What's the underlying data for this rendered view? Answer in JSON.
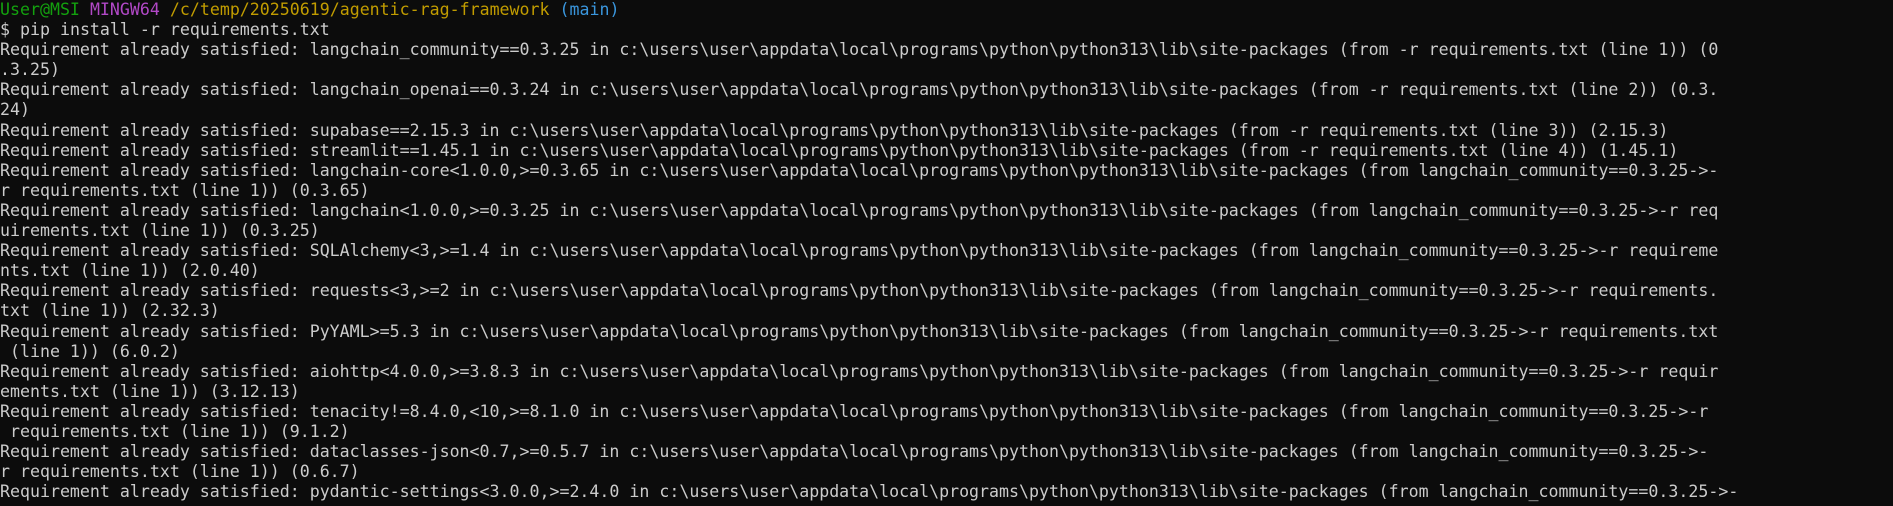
{
  "prompt": {
    "user_host": "User@MSI",
    "shell": "MINGW64",
    "path": "/c/temp/20250619/agentic-rag-framework",
    "branch": "(main)",
    "symbol": "$",
    "command": "pip install -r requirements.txt"
  },
  "lines": [
    "Requirement already satisfied: langchain_community==0.3.25 in c:\\users\\user\\appdata\\local\\programs\\python\\python313\\lib\\site-packages (from -r requirements.txt (line 1)) (0",
    ".3.25)",
    "Requirement already satisfied: langchain_openai==0.3.24 in c:\\users\\user\\appdata\\local\\programs\\python\\python313\\lib\\site-packages (from -r requirements.txt (line 2)) (0.3.",
    "24)",
    "Requirement already satisfied: supabase==2.15.3 in c:\\users\\user\\appdata\\local\\programs\\python\\python313\\lib\\site-packages (from -r requirements.txt (line 3)) (2.15.3)",
    "Requirement already satisfied: streamlit==1.45.1 in c:\\users\\user\\appdata\\local\\programs\\python\\python313\\lib\\site-packages (from -r requirements.txt (line 4)) (1.45.1)",
    "Requirement already satisfied: langchain-core<1.0.0,>=0.3.65 in c:\\users\\user\\appdata\\local\\programs\\python\\python313\\lib\\site-packages (from langchain_community==0.3.25->-",
    "r requirements.txt (line 1)) (0.3.65)",
    "Requirement already satisfied: langchain<1.0.0,>=0.3.25 in c:\\users\\user\\appdata\\local\\programs\\python\\python313\\lib\\site-packages (from langchain_community==0.3.25->-r req",
    "uirements.txt (line 1)) (0.3.25)",
    "Requirement already satisfied: SQLAlchemy<3,>=1.4 in c:\\users\\user\\appdata\\local\\programs\\python\\python313\\lib\\site-packages (from langchain_community==0.3.25->-r requireme",
    "nts.txt (line 1)) (2.0.40)",
    "Requirement already satisfied: requests<3,>=2 in c:\\users\\user\\appdata\\local\\programs\\python\\python313\\lib\\site-packages (from langchain_community==0.3.25->-r requirements.",
    "txt (line 1)) (2.32.3)",
    "Requirement already satisfied: PyYAML>=5.3 in c:\\users\\user\\appdata\\local\\programs\\python\\python313\\lib\\site-packages (from langchain_community==0.3.25->-r requirements.txt",
    " (line 1)) (6.0.2)",
    "Requirement already satisfied: aiohttp<4.0.0,>=3.8.3 in c:\\users\\user\\appdata\\local\\programs\\python\\python313\\lib\\site-packages (from langchain_community==0.3.25->-r requir",
    "ements.txt (line 1)) (3.12.13)",
    "Requirement already satisfied: tenacity!=8.4.0,<10,>=8.1.0 in c:\\users\\user\\appdata\\local\\programs\\python\\python313\\lib\\site-packages (from langchain_community==0.3.25->-r",
    " requirements.txt (line 1)) (9.1.2)",
    "Requirement already satisfied: dataclasses-json<0.7,>=0.5.7 in c:\\users\\user\\appdata\\local\\programs\\python\\python313\\lib\\site-packages (from langchain_community==0.3.25->-",
    "r requirements.txt (line 1)) (0.6.7)",
    "Requirement already satisfied: pydantic-settings<3.0.0,>=2.4.0 in c:\\users\\user\\appdata\\local\\programs\\python\\python313\\lib\\site-packages (from langchain_community==0.3.25->-"
  ]
}
